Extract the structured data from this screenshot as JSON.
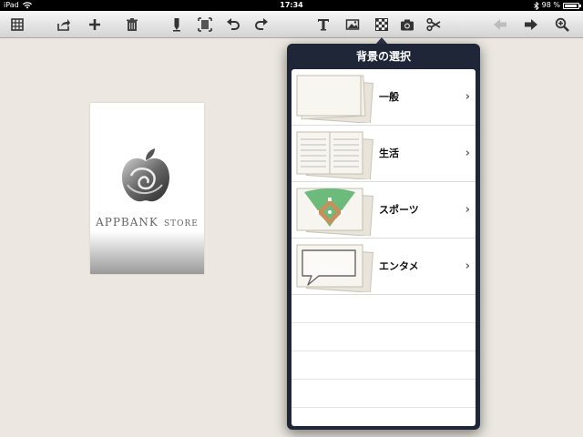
{
  "status": {
    "device": "iPad",
    "time": "17:34",
    "battery": "98 %"
  },
  "card": {
    "brand_big": "APPBANK",
    "brand_small": "STORE"
  },
  "popover": {
    "title": "背景の選択",
    "items": [
      {
        "label": "一般"
      },
      {
        "label": "生活"
      },
      {
        "label": "スポーツ"
      },
      {
        "label": "エンタメ"
      }
    ]
  },
  "icons": [
    "grid-icon",
    "share-icon",
    "plus-icon",
    "trash-icon",
    "pen-icon",
    "crop-icon",
    "undo-icon",
    "redo-icon",
    "text-icon",
    "image-icon",
    "background-pattern-icon",
    "camera-icon",
    "scissors-icon",
    "prev-page-icon",
    "next-page-icon",
    "zoom-in-icon"
  ]
}
